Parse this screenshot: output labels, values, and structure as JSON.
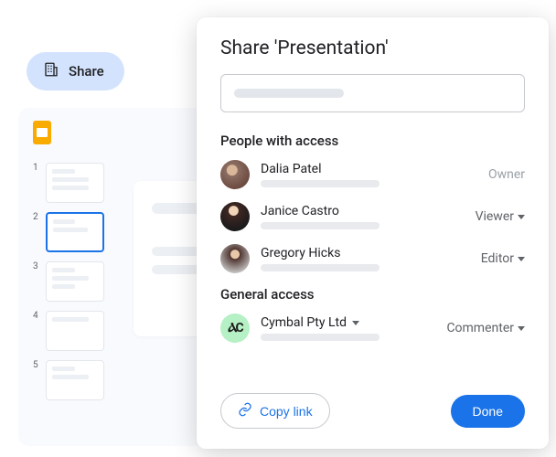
{
  "share_pill": {
    "label": "Share"
  },
  "dialog": {
    "title": "Share 'Presentation'",
    "section_people": "People with access",
    "section_general": "General access",
    "people": [
      {
        "name": "Dalia Patel",
        "role": "Owner",
        "role_type": "owner"
      },
      {
        "name": "Janice Castro",
        "role": "Viewer",
        "role_type": "dropdown"
      },
      {
        "name": "Gregory Hicks",
        "role": "Editor",
        "role_type": "dropdown"
      }
    ],
    "general": {
      "org": "Cymbal Pty Ltd",
      "role": "Commenter"
    },
    "copy_link": "Copy link",
    "done": "Done"
  },
  "thumbs": [
    "1",
    "2",
    "3",
    "4",
    "5"
  ]
}
